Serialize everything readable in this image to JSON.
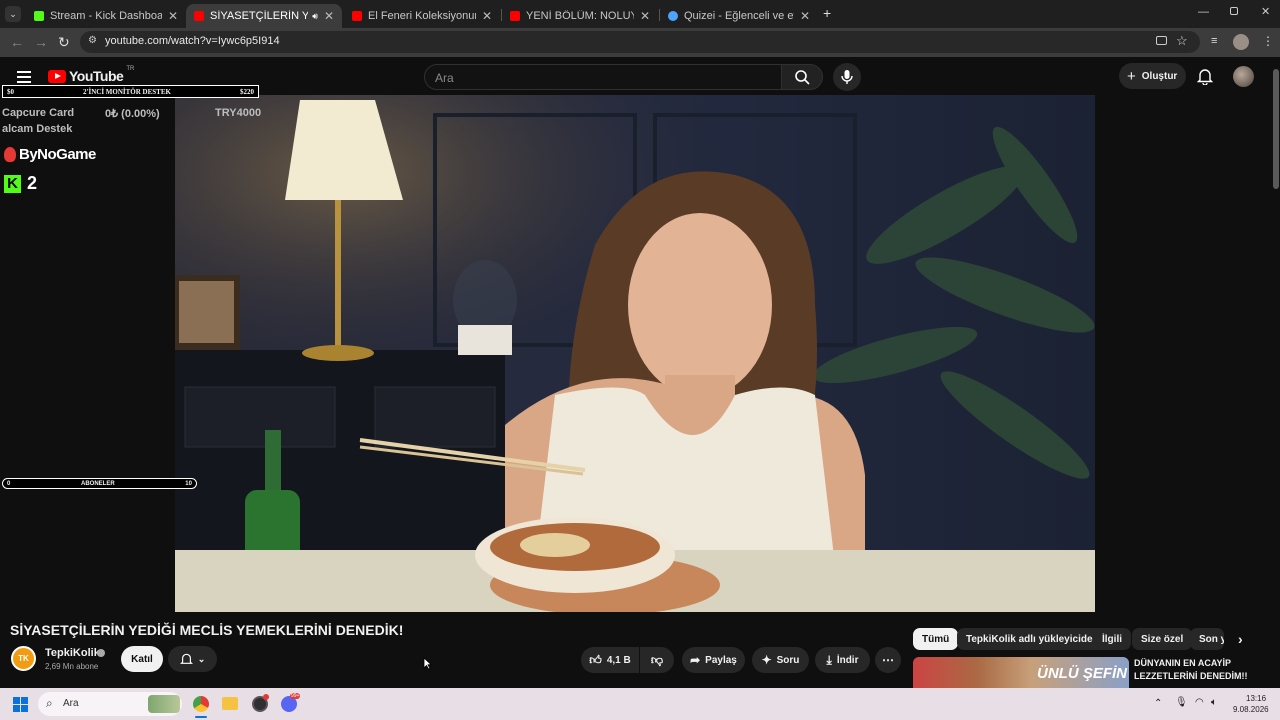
{
  "browser": {
    "tabs": [
      {
        "title": "Stream - Kick Dashboard",
        "favicon_color": "#53fc18"
      },
      {
        "title": "SİYASETÇİLERİN YEDİĞİ ME",
        "favicon_color": "#ff0000",
        "active": true
      },
      {
        "title": "El Feneri Koleksiyonumun Favo",
        "favicon_color": "#ff0000"
      },
      {
        "title": "YENİ BÖLÜM: NOLUYO YA ¿ VS",
        "favicon_color": "#ff0000"
      },
      {
        "title": "Quizei - Eğlenceli ve etkileşimli",
        "favicon_color": "#4ea3ff"
      }
    ],
    "new_tab_label": "+",
    "url": "youtube.com/watch?v=Iywc6p5I914"
  },
  "youtube": {
    "logo_text": "YouTube",
    "logo_region": "TR",
    "search_placeholder": "Ara",
    "create_label": "Oluştur"
  },
  "overlay": {
    "goal_left": "$0",
    "goal_title": "2'İNCİ MONİTÖR DESTEK",
    "goal_right": "$220",
    "donation_label": "Capcure Card",
    "donation_amount": "0₺ (0.00%)",
    "donation_target": "TRY4000",
    "donation_sub": "alcam Destek",
    "brand": "ByNoGame",
    "kick_count": "2",
    "subs_left": "0",
    "subs_title": "ABONELER",
    "subs_right": "10"
  },
  "video": {
    "title": "SİYASETÇİLERİN YEDİĞİ MECLİS YEMEKLERİNİ DENEDİK!",
    "channel_name": "TepkiKolik",
    "channel_avatar_text": "TK",
    "subscribers": "2,69 Mn abone",
    "join_label": "Katıl",
    "likes": "4,1 B",
    "share_label": "Paylaş",
    "ask_label": "Soru",
    "download_label": "İndir"
  },
  "chips": [
    "Tümü",
    "TepkiKolik adlı yükleyiciden",
    "İlgili",
    "Size özel",
    "Son y"
  ],
  "recommendation": {
    "title_line1": "DÜNYANIN EN ACAYİP",
    "title_line2": "LEZZETLERİNİ DENEDİM!!",
    "thumb_text": "ÜNLÜ ŞEFİN"
  },
  "taskbar": {
    "search_placeholder": "Ara",
    "time": "13:16",
    "date": "9.08.2026",
    "discord_badge": "99+"
  }
}
